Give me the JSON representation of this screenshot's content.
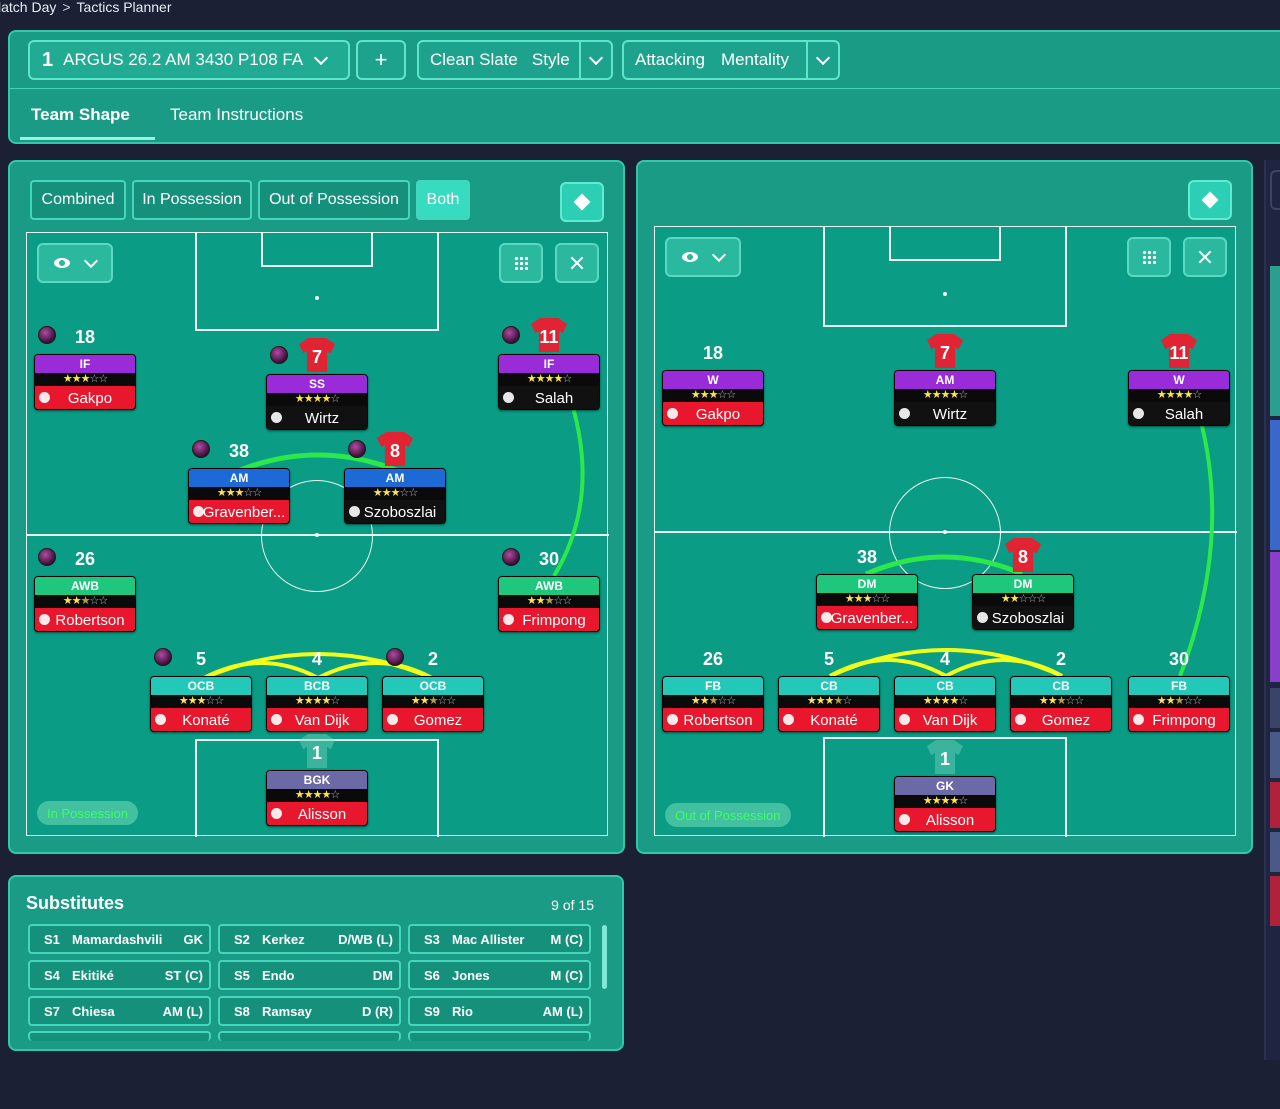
{
  "breadcrumb": {
    "first": "latch Day",
    "second": "Tactics Planner"
  },
  "tactic": {
    "slot": "1",
    "name": "ARGUS 26.2 AM 3430 P108 FA",
    "add_label": "+"
  },
  "style": {
    "value": "Clean Slate",
    "label": "Style"
  },
  "mentality": {
    "value": "Attacking",
    "label": "Mentality"
  },
  "tabs": {
    "team_shape": "Team Shape",
    "team_instructions": "Team Instructions"
  },
  "phase_tabs": {
    "combined": "Combined",
    "in_possession": "In Possession",
    "out_of_possession": "Out of Possession",
    "both": "Both"
  },
  "left_pitch": {
    "label": "In Possession",
    "players": [
      {
        "num": "18",
        "role": "IF",
        "stars": 3,
        "name": "Gakpo"
      },
      {
        "num": "7",
        "role": "SS",
        "stars": 4,
        "name": "Wirtz"
      },
      {
        "num": "11",
        "role": "IF",
        "stars": 4,
        "name": "Salah"
      },
      {
        "num": "38",
        "role": "AM",
        "stars": 3,
        "name": "Gravenber..."
      },
      {
        "num": "8",
        "role": "AM",
        "stars": 3,
        "name": "Szoboszlai"
      },
      {
        "num": "26",
        "role": "AWB",
        "stars": 2.5,
        "name": "Robertson"
      },
      {
        "num": "30",
        "role": "AWB",
        "stars": 2.5,
        "name": "Frimpong"
      },
      {
        "num": "5",
        "role": "OCB",
        "stars": 3,
        "name": "Konaté"
      },
      {
        "num": "4",
        "role": "BCB",
        "stars": 4,
        "name": "Van Dijk"
      },
      {
        "num": "2",
        "role": "OCB",
        "stars": 2.5,
        "name": "Gomez"
      },
      {
        "num": "1",
        "role": "BGK",
        "stars": 4,
        "name": "Alisson"
      }
    ]
  },
  "right_pitch": {
    "label": "Out of Possession",
    "players": [
      {
        "num": "18",
        "role": "W",
        "stars": 3,
        "name": "Gakpo"
      },
      {
        "num": "7",
        "role": "AM",
        "stars": 4,
        "name": "Wirtz"
      },
      {
        "num": "11",
        "role": "W",
        "stars": 4,
        "name": "Salah"
      },
      {
        "num": "38",
        "role": "DM",
        "stars": 3,
        "name": "Gravenber..."
      },
      {
        "num": "8",
        "role": "DM",
        "stars": 2,
        "name": "Szoboszlai"
      },
      {
        "num": "26",
        "role": "FB",
        "stars": 2.5,
        "name": "Robertson"
      },
      {
        "num": "5",
        "role": "CB",
        "stars": 3.5,
        "name": "Konaté"
      },
      {
        "num": "4",
        "role": "CB",
        "stars": 4,
        "name": "Van Dijk"
      },
      {
        "num": "2",
        "role": "CB",
        "stars": 2.5,
        "name": "Gomez"
      },
      {
        "num": "30",
        "role": "FB",
        "stars": 2.5,
        "name": "Frimpong"
      },
      {
        "num": "1",
        "role": "GK",
        "stars": 4,
        "name": "Alisson"
      }
    ]
  },
  "substitutes": {
    "title": "Substitutes",
    "count": "9 of 15",
    "items": [
      {
        "slot": "S1",
        "name": "Mamardashvili",
        "pos": "GK"
      },
      {
        "slot": "S2",
        "name": "Kerkez",
        "pos": "D/WB (L)"
      },
      {
        "slot": "S3",
        "name": "Mac Allister",
        "pos": "M (C)"
      },
      {
        "slot": "S4",
        "name": "Ekitiké",
        "pos": "ST (C)"
      },
      {
        "slot": "S5",
        "name": "Endo",
        "pos": "DM"
      },
      {
        "slot": "S6",
        "name": "Jones",
        "pos": "M (C)"
      },
      {
        "slot": "S7",
        "name": "Chiesa",
        "pos": "AM (L)"
      },
      {
        "slot": "S8",
        "name": "Ramsay",
        "pos": "D (R)"
      },
      {
        "slot": "S9",
        "name": "Rio",
        "pos": "AM (L)"
      }
    ]
  },
  "colors": {
    "panel": "#1a9b86",
    "pitch": "#0a9c84",
    "accent": "#36dbc0",
    "bg": "#1b2035"
  }
}
